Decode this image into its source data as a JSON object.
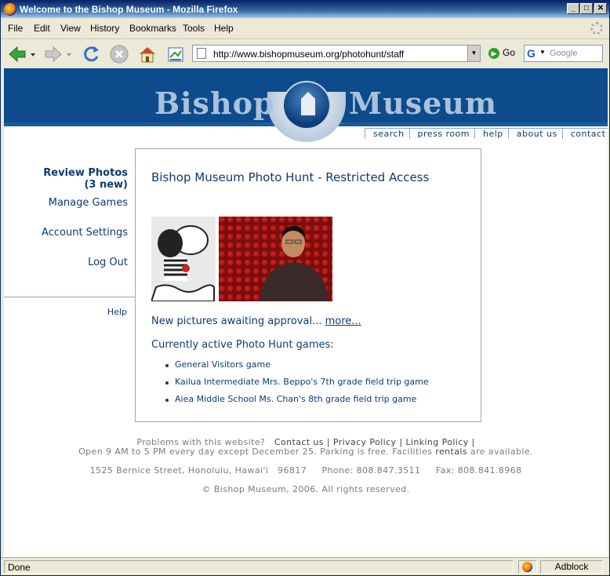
{
  "window": {
    "title": "Welcome to the Bishop Museum - Mozilla Firefox",
    "minimize": "_",
    "maximize": "□",
    "close": "✕"
  },
  "menubar": {
    "items": [
      "File",
      "Edit",
      "View",
      "History",
      "Bookmarks",
      "Tools",
      "Help"
    ]
  },
  "navbar": {
    "url": "http://www.bishopmuseum.org/photohunt/staff",
    "go_label": "Go",
    "search_placeholder": "Google",
    "search_engine_glyph": "G"
  },
  "site": {
    "logo_left": "Bishop",
    "logo_right": "Museum",
    "top_links": [
      "search",
      "press room",
      "help",
      "about us",
      "contact"
    ]
  },
  "leftnav": {
    "review_photos": "Review Photos",
    "review_count": "(3 new)",
    "manage_games": "Manage Games",
    "account_settings": "Account Settings",
    "log_out": "Log Out",
    "help": "Help"
  },
  "main": {
    "heading": "Bishop Museum Photo Hunt - Restricted Access",
    "awaiting_text": "New pictures awaiting approval...",
    "more_link": "more...",
    "active_games_label": "Currently active Photo Hunt games:",
    "games": [
      "General Visitors game",
      "Kailua Intermediate Mrs. Beppo's 7th grade field trip game",
      "Aiea Middle School Ms. Chan's 8th grade field trip game"
    ]
  },
  "footer": {
    "problems": "Problems with this website?",
    "contact_us": "Contact us",
    "privacy": "Privacy Policy",
    "linking": "Linking Policy",
    "sep": "|",
    "hours_a": "Open 9 AM to 5 PM every day except December 25.   Parking is free.   Facilities",
    "rentals": "rentals",
    "hours_b": "are available.",
    "address": "1525 Bernice Street, Honolulu, Hawai'i   96817     Phone: 808.847.3511     Fax: 808.841.8968",
    "copyright": "© Bishop Museum, 2006. All rights reserved."
  },
  "statusbar": {
    "status": "Done",
    "adblock": "Adblock"
  },
  "colors": {
    "site_blue": "#0d4b8c",
    "link_navy": "#0d3b73",
    "title_bar": "#0a246a"
  }
}
